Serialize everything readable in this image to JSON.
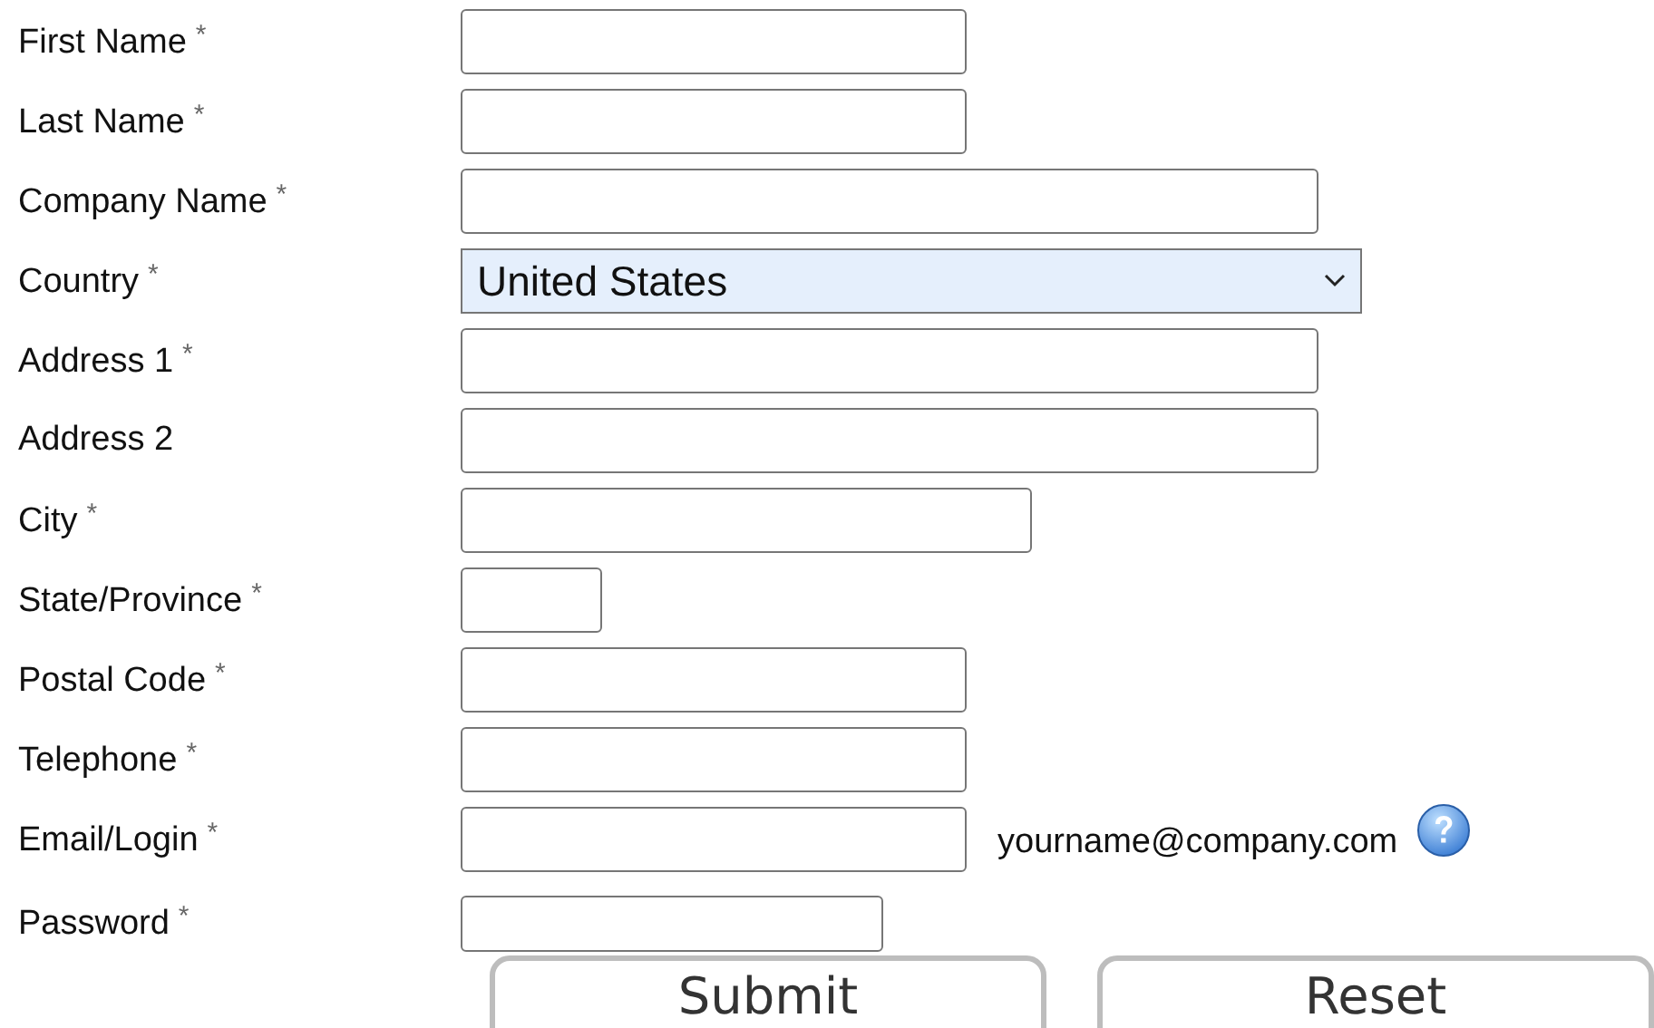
{
  "fields": [
    {
      "label": "First Name",
      "required": true,
      "kind": "text"
    },
    {
      "label": "Last Name",
      "required": true,
      "kind": "text"
    },
    {
      "label": "Company Name",
      "required": true,
      "kind": "text"
    },
    {
      "label": "Country",
      "required": true,
      "kind": "select",
      "value": "United States"
    },
    {
      "label": "Address 1",
      "required": true,
      "kind": "text"
    },
    {
      "label": "Address 2",
      "required": false,
      "kind": "text"
    },
    {
      "label": "City",
      "required": true,
      "kind": "text"
    },
    {
      "label": "State/Province",
      "required": true,
      "kind": "text"
    },
    {
      "label": "Postal Code",
      "required": true,
      "kind": "text"
    },
    {
      "label": "Telephone",
      "required": true,
      "kind": "text"
    },
    {
      "label": "Email/Login",
      "required": true,
      "kind": "text",
      "hint": "yourname@company.com",
      "help": true
    },
    {
      "label": "Password",
      "required": true,
      "kind": "password"
    }
  ],
  "required_mark": "*",
  "buttons": [
    "Submit",
    "Reset"
  ]
}
